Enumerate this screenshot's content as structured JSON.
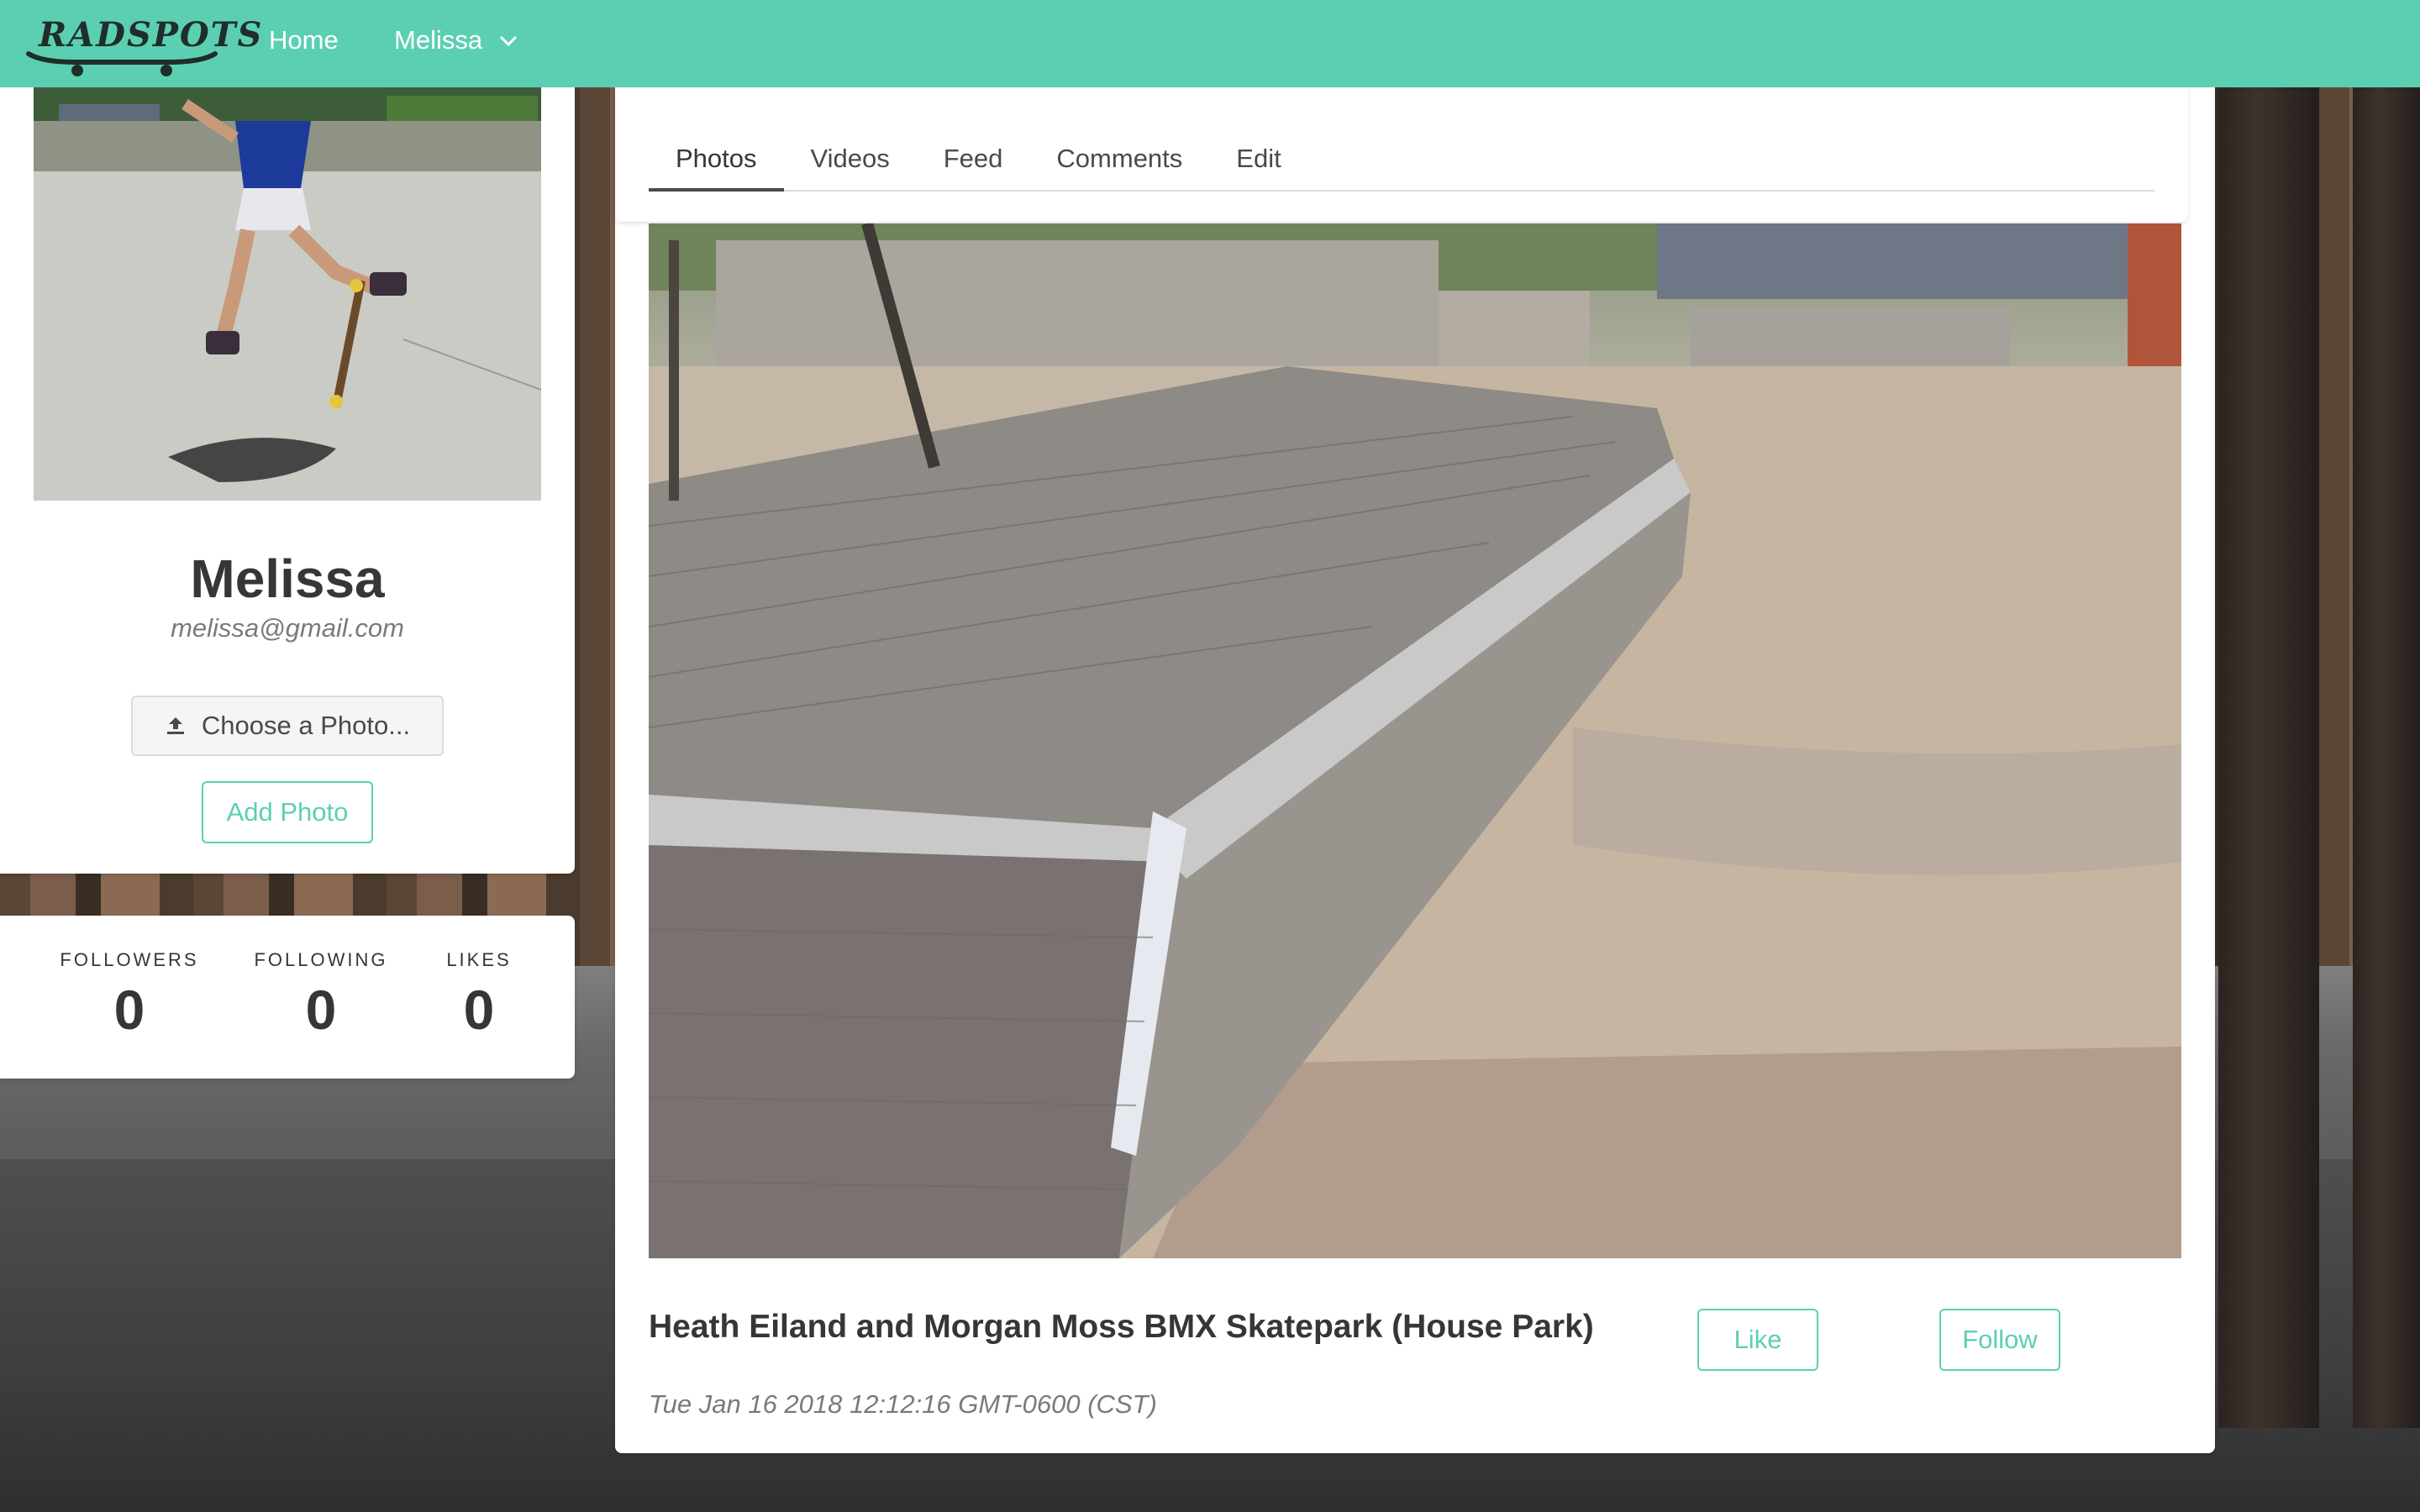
{
  "navbar": {
    "logo_text": "RADSPOTS",
    "home_label": "Home",
    "user_label": "Melissa",
    "bg_color": "#5ccfb3"
  },
  "profile": {
    "name": "Melissa",
    "email": "melissa@gmail.com",
    "choose_photo_label": "Choose a Photo...",
    "add_photo_label": "Add Photo",
    "upload_icon": "upload-icon"
  },
  "stats": [
    {
      "label": "FOLLOWERS",
      "value": "0"
    },
    {
      "label": "FOLLOWING",
      "value": "0"
    },
    {
      "label": "LIKES",
      "value": "0"
    }
  ],
  "tabs": [
    {
      "label": "Photos",
      "active": true
    },
    {
      "label": "Videos",
      "active": false
    },
    {
      "label": "Feed",
      "active": false
    },
    {
      "label": "Comments",
      "active": false
    },
    {
      "label": "Edit",
      "active": false
    }
  ],
  "post": {
    "title": "Heath Eiland and Morgan Moss BMX Skatepark (House Park)",
    "date": "Tue Jan 16 2018 12:12:16 GMT-0600 (CST)",
    "like_label": "Like",
    "follow_label": "Follow"
  },
  "colors": {
    "accent": "#5ccfb3",
    "text": "#363636",
    "muted": "#7a7a7a"
  }
}
